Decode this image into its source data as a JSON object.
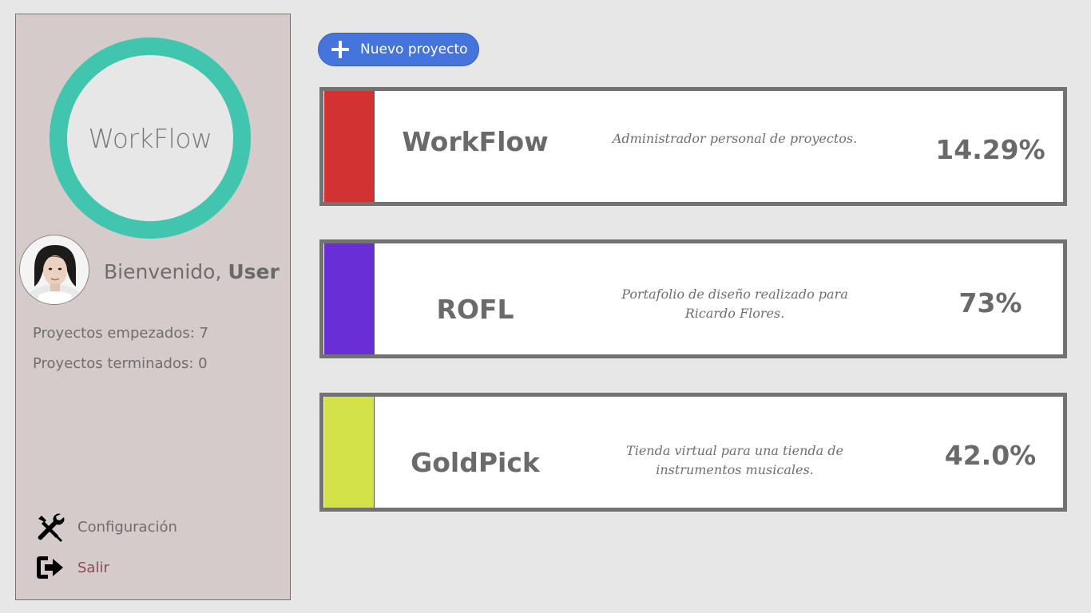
{
  "app": {
    "logo_text": "WorkFlow",
    "accent_color": "#42c5ae"
  },
  "user": {
    "welcome_prefix": "Bienvenido, ",
    "name": "User",
    "stats": {
      "started": "Proyectos empezados: 7",
      "finished": "Proyectos terminados: 0"
    }
  },
  "menu": {
    "config": {
      "label": "Configuración",
      "icon": "tools-icon"
    },
    "exit": {
      "label": "Salir",
      "icon": "exit-icon"
    }
  },
  "toolbar": {
    "new_project_label": "Nuevo proyecto",
    "new_project_icon": "plus-icon",
    "button_color": "#4574dc"
  },
  "projects": [
    {
      "name": "WorkFlow",
      "description": "Administrador personal de proyectos.",
      "progress": "14.29%",
      "color": "#d33232"
    },
    {
      "name": "ROFL",
      "description": "Portafolio de diseño realizado para Ricardo Flores.",
      "progress": "73%",
      "color": "#6a2ed6"
    },
    {
      "name": "GoldPick",
      "description": "Tienda virtual para una tienda de instrumentos musicales.",
      "progress": "42.0%",
      "color": "#d4e24a"
    }
  ]
}
